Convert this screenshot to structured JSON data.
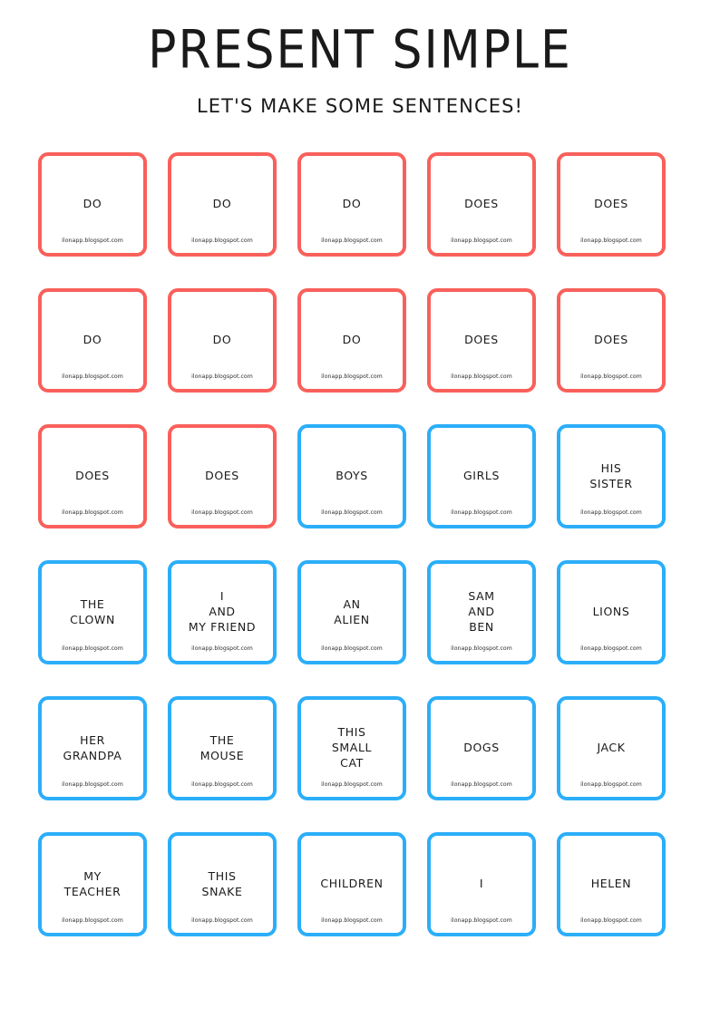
{
  "header": {
    "title": "PRESENT SIMPLE",
    "subtitle": "LET'S MAKE SOME SENTENCES!"
  },
  "colors": {
    "auxiliary_card_border": "#f9605b",
    "subject_card_border": "#2baef9",
    "text": "#1a1a1a",
    "page_background": "#ffffff"
  },
  "watermark": "ilonapp.blogspot.com",
  "grid": {
    "columns": 5,
    "rows": 6,
    "cards": [
      {
        "lines": [
          "DO"
        ],
        "type": "auxiliary",
        "color": "#f9605b",
        "watermark": "ilonapp.blogspot.com"
      },
      {
        "lines": [
          "DO"
        ],
        "type": "auxiliary",
        "color": "#f9605b",
        "watermark": "ilonapp.blogspot.com"
      },
      {
        "lines": [
          "DO"
        ],
        "type": "auxiliary",
        "color": "#f9605b",
        "watermark": "ilonapp.blogspot.com"
      },
      {
        "lines": [
          "DOES"
        ],
        "type": "auxiliary",
        "color": "#f9605b",
        "watermark": "ilonapp.blogspot.com"
      },
      {
        "lines": [
          "DOES"
        ],
        "type": "auxiliary",
        "color": "#f9605b",
        "watermark": "ilonapp.blogspot.com"
      },
      {
        "lines": [
          "DO"
        ],
        "type": "auxiliary",
        "color": "#f9605b",
        "watermark": "ilonapp.blogspot.com"
      },
      {
        "lines": [
          "DO"
        ],
        "type": "auxiliary",
        "color": "#f9605b",
        "watermark": "ilonapp.blogspot.com"
      },
      {
        "lines": [
          "DO"
        ],
        "type": "auxiliary",
        "color": "#f9605b",
        "watermark": "ilonapp.blogspot.com"
      },
      {
        "lines": [
          "DOES"
        ],
        "type": "auxiliary",
        "color": "#f9605b",
        "watermark": "ilonapp.blogspot.com"
      },
      {
        "lines": [
          "DOES"
        ],
        "type": "auxiliary",
        "color": "#f9605b",
        "watermark": "ilonapp.blogspot.com"
      },
      {
        "lines": [
          "DOES"
        ],
        "type": "auxiliary",
        "color": "#f9605b",
        "watermark": "ilonapp.blogspot.com"
      },
      {
        "lines": [
          "DOES"
        ],
        "type": "auxiliary",
        "color": "#f9605b",
        "watermark": "ilonapp.blogspot.com"
      },
      {
        "lines": [
          "BOYS"
        ],
        "type": "subject",
        "color": "#2baef9",
        "watermark": "ilonapp.blogspot.com"
      },
      {
        "lines": [
          "GIRLS"
        ],
        "type": "subject",
        "color": "#2baef9",
        "watermark": "ilonapp.blogspot.com"
      },
      {
        "lines": [
          "HIS",
          "SISTER"
        ],
        "type": "subject",
        "color": "#2baef9",
        "watermark": "ilonapp.blogspot.com"
      },
      {
        "lines": [
          "THE",
          "CLOWN"
        ],
        "type": "subject",
        "color": "#2baef9",
        "watermark": "ilonapp.blogspot.com"
      },
      {
        "lines": [
          "I",
          "AND",
          "MY FRIEND"
        ],
        "type": "subject",
        "color": "#2baef9",
        "watermark": "ilonapp.blogspot.com"
      },
      {
        "lines": [
          "AN",
          "ALIEN"
        ],
        "type": "subject",
        "color": "#2baef9",
        "watermark": "ilonapp.blogspot.com"
      },
      {
        "lines": [
          "SAM",
          "AND",
          "BEN"
        ],
        "type": "subject",
        "color": "#2baef9",
        "watermark": "ilonapp.blogspot.com"
      },
      {
        "lines": [
          "LIONS"
        ],
        "type": "subject",
        "color": "#2baef9",
        "watermark": "ilonapp.blogspot.com"
      },
      {
        "lines": [
          "HER",
          "GRANDPA"
        ],
        "type": "subject",
        "color": "#2baef9",
        "watermark": "ilonapp.blogspot.com"
      },
      {
        "lines": [
          "THE",
          "MOUSE"
        ],
        "type": "subject",
        "color": "#2baef9",
        "watermark": "ilonapp.blogspot.com"
      },
      {
        "lines": [
          "THIS",
          "SMALL",
          "CAT"
        ],
        "type": "subject",
        "color": "#2baef9",
        "watermark": "ilonapp.blogspot.com"
      },
      {
        "lines": [
          "DOGS"
        ],
        "type": "subject",
        "color": "#2baef9",
        "watermark": "ilonapp.blogspot.com"
      },
      {
        "lines": [
          "JACK"
        ],
        "type": "subject",
        "color": "#2baef9",
        "watermark": "ilonapp.blogspot.com"
      },
      {
        "lines": [
          "MY",
          "TEACHER"
        ],
        "type": "subject",
        "color": "#2baef9",
        "watermark": "ilonapp.blogspot.com"
      },
      {
        "lines": [
          "THIS",
          "SNAKE"
        ],
        "type": "subject",
        "color": "#2baef9",
        "watermark": "ilonapp.blogspot.com"
      },
      {
        "lines": [
          "CHILDREN"
        ],
        "type": "subject",
        "color": "#2baef9",
        "watermark": "ilonapp.blogspot.com"
      },
      {
        "lines": [
          "I"
        ],
        "type": "subject",
        "color": "#2baef9",
        "watermark": "ilonapp.blogspot.com"
      },
      {
        "lines": [
          "HELEN"
        ],
        "type": "subject",
        "color": "#2baef9",
        "watermark": "ilonapp.blogspot.com"
      }
    ]
  }
}
